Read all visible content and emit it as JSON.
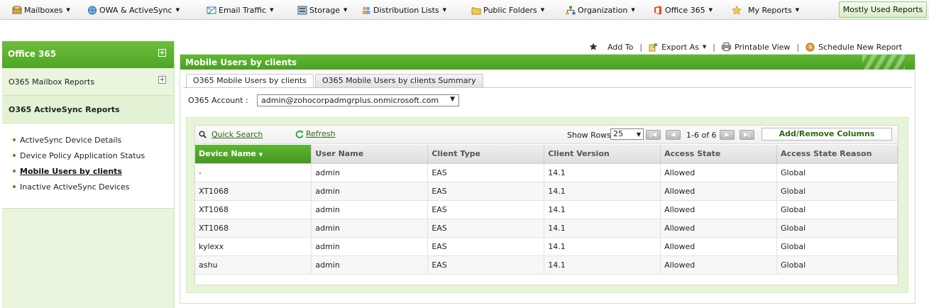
{
  "nav": {
    "items": [
      {
        "label": "Mailboxes",
        "icon": "mailbox-icon"
      },
      {
        "label": "OWA & ActiveSync",
        "icon": "globe-icon"
      },
      {
        "label": "Email Traffic",
        "icon": "email-traffic-icon"
      },
      {
        "label": "Storage",
        "icon": "storage-icon"
      },
      {
        "label": "Distribution Lists",
        "icon": "users-icon"
      },
      {
        "label": "Public Folders",
        "icon": "folder-icon"
      },
      {
        "label": "Organization",
        "icon": "org-chart-icon"
      },
      {
        "label": "Office 365",
        "icon": "office-icon"
      },
      {
        "label": "My Reports",
        "icon": "star-icon"
      }
    ],
    "mostly_used": "Mostly Used Reports"
  },
  "sidebar": {
    "header": "Office 365",
    "sections": [
      {
        "label": "O365 Mailbox Reports"
      },
      {
        "label": "O365 ActiveSync Reports"
      }
    ],
    "items": [
      {
        "label": "ActiveSync Device Details"
      },
      {
        "label": "Device Policy Application Status"
      },
      {
        "label": "Mobile Users by clients"
      },
      {
        "label": "Inactive ActiveSync Devices"
      }
    ],
    "active_index": 2
  },
  "toolbar": {
    "add_to": "Add To",
    "export_as": "Export As",
    "printable_view": "Printable View",
    "schedule": "Schedule New Report",
    "separator": "|"
  },
  "panel": {
    "title": "Mobile Users by clients",
    "tabs": [
      "O365 Mobile Users by clients",
      "O365 Mobile Users by clients Summary"
    ],
    "account_label": "O365 Account :",
    "account_value": "admin@zohocorpadmgrplus.onmicrosoft.com"
  },
  "grid": {
    "quick_search": "Quick Search",
    "refresh": "Refresh",
    "show_rows_label": "Show Rows",
    "rows_value": "25",
    "page_info": "1-6 of 6",
    "add_remove": "Add/Remove Columns",
    "columns": [
      "Device Name",
      "User Name",
      "Client Type",
      "Client Version",
      "Access State",
      "Access State Reason"
    ],
    "rows": [
      [
        "-",
        "admin",
        "EAS",
        "14.1",
        "Allowed",
        "Global"
      ],
      [
        "XT1068",
        "admin",
        "EAS",
        "14.1",
        "Allowed",
        "Global"
      ],
      [
        "XT1068",
        "admin",
        "EAS",
        "14.1",
        "Allowed",
        "Global"
      ],
      [
        "XT1068",
        "admin",
        "EAS",
        "14.1",
        "Allowed",
        "Global"
      ],
      [
        "kylexx",
        "admin",
        "EAS",
        "14.1",
        "Allowed",
        "Global"
      ],
      [
        "ashu",
        "admin",
        "EAS",
        "14.1",
        "Allowed",
        "Global"
      ]
    ]
  },
  "colors": {
    "brand_green": "#4fa526",
    "link_green": "#2d6a12",
    "sidebar_bg": "#e9f5dc"
  }
}
